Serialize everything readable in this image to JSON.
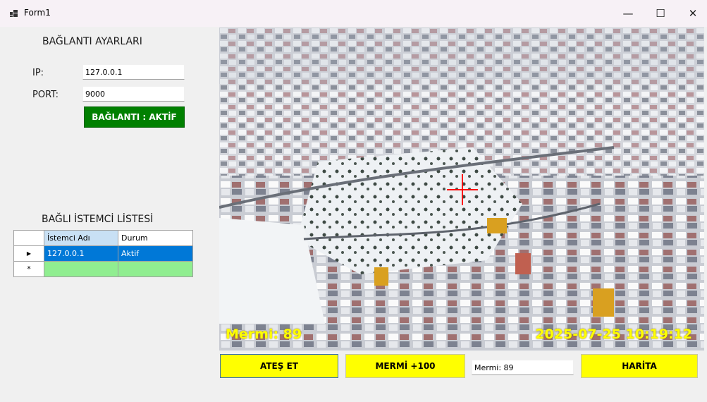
{
  "window": {
    "title": "Form1",
    "minimize": "—",
    "maximize": "☐",
    "close": "✕"
  },
  "connection": {
    "heading": "BAĞLANTI AYARLARI",
    "ip_label": "IP:",
    "ip_value": "127.0.0.1",
    "port_label": "PORT:",
    "port_value": "9000",
    "status_label": "BAĞLANTI : AKTİF",
    "status_color": "#008000"
  },
  "clients": {
    "heading": "BAĞLI İSTEMCİ LİSTESİ",
    "columns": [
      "İstemci Adı",
      "Durum"
    ],
    "rows": [
      {
        "name": "127.0.0.1",
        "status": "Aktif",
        "selected": true
      }
    ],
    "new_row_marker": "*",
    "selected_color": "#0078d7",
    "new_row_color": "#90ee90"
  },
  "video": {
    "ammo_overlay": "Mermi: 89",
    "timestamp_overlay": "2025-07-25 10:19:12",
    "overlay_color": "#ffff00",
    "crosshair_color": "#ff0000"
  },
  "controls": {
    "fire_label": "ATEŞ ET",
    "ammo_add_label": "MERMİ +100",
    "ammo_field_value": "Mermi: 89",
    "map_label": "HARİTA",
    "button_color": "#ffff00"
  }
}
